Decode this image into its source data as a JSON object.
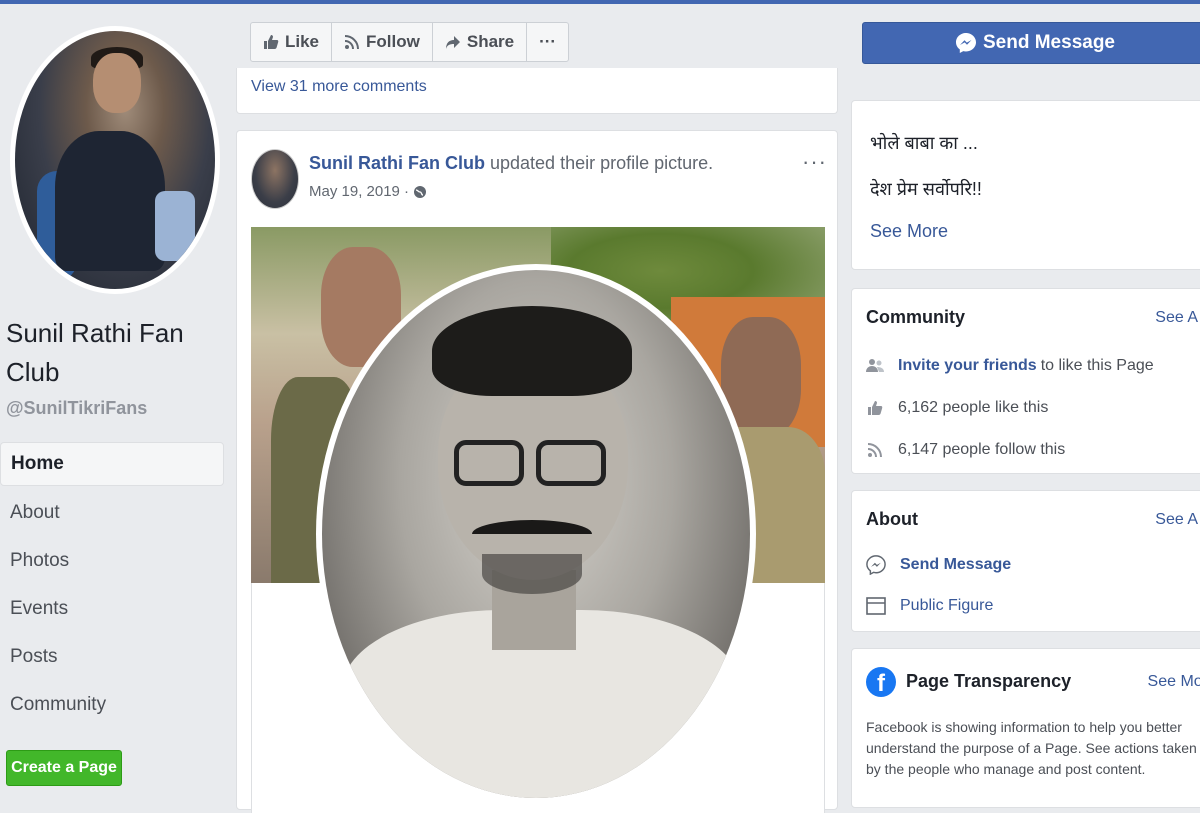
{
  "colors": {
    "accent": "#4267b2",
    "link": "#385898",
    "green": "#42b72a"
  },
  "page": {
    "name": "Sunil Rathi Fan Club",
    "handle": "@SunilTikriFans"
  },
  "nav": {
    "items": [
      {
        "label": "Home",
        "active": true
      },
      {
        "label": "About"
      },
      {
        "label": "Photos"
      },
      {
        "label": "Events"
      },
      {
        "label": "Posts"
      },
      {
        "label": "Community"
      }
    ],
    "create_label": "Create a Page"
  },
  "actions": {
    "like": "Like",
    "follow": "Follow",
    "share": "Share",
    "more": "···"
  },
  "comments": {
    "view_more": "View 31 more comments"
  },
  "post": {
    "author": "Sunil Rathi Fan Club",
    "text": " updated their profile picture.",
    "date": "May 19, 2019 ·",
    "menu": "···"
  },
  "send_message": {
    "label": "Send Message"
  },
  "bio": {
    "line1": "भोले बाबा का ...",
    "line2": "देश प्रेम सर्वोपरि!!",
    "see_more": "See More"
  },
  "community": {
    "title": "Community",
    "see_all": "See A",
    "invite_link": "Invite your friends",
    "invite_rest": "to like this Page",
    "likes": "6,162 people like this",
    "follows": "6,147 people follow this"
  },
  "about": {
    "title": "About",
    "see_all": "See A",
    "send_message": "Send Message",
    "category": "Public Figure"
  },
  "transparency": {
    "title": "Page Transparency",
    "see_more": "See Mor",
    "text": "Facebook is showing information to help you better understand the purpose of a Page. See actions taken by the people who manage and post content."
  },
  "icons": [
    "thumbs-up-icon",
    "rss-icon",
    "share-icon",
    "messenger-icon",
    "globe-icon",
    "people-icon",
    "info-icon",
    "flag-icon",
    "facebook-logo-icon"
  ]
}
